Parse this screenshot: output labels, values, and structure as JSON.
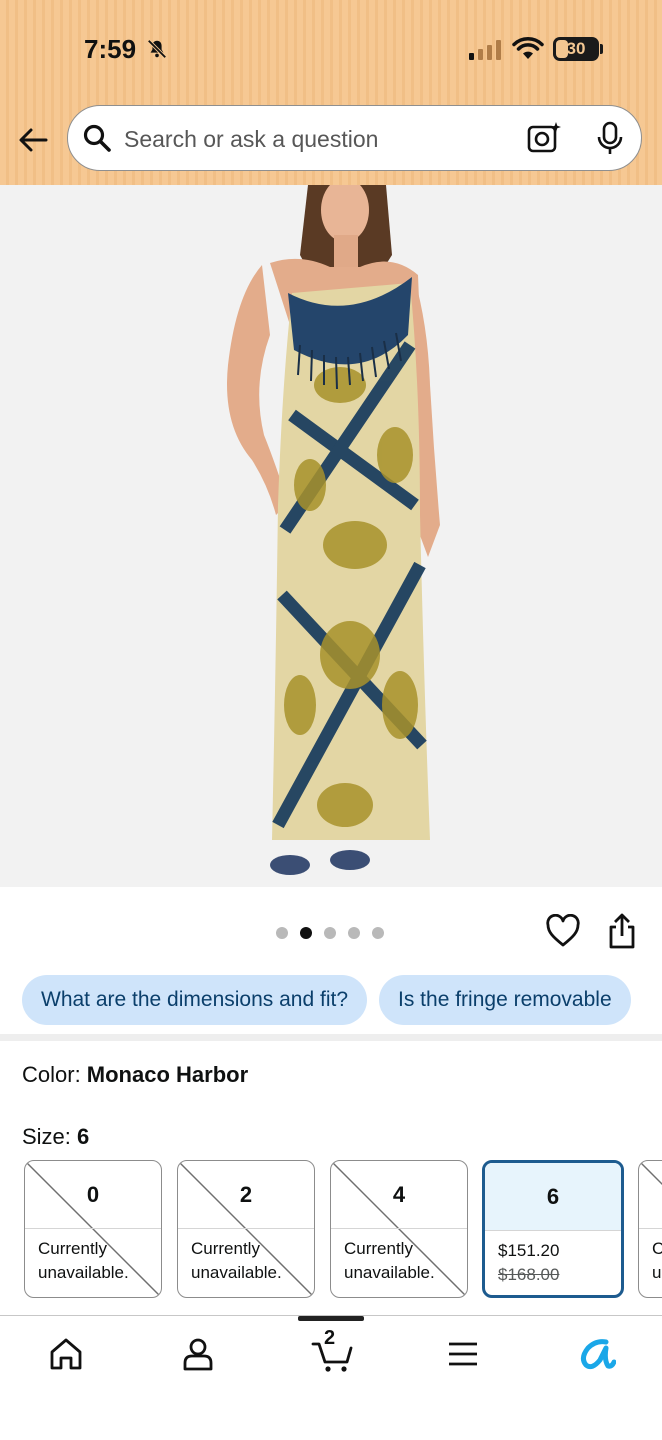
{
  "status_bar": {
    "time": "7:59",
    "battery": "30"
  },
  "search": {
    "placeholder": "Search or ask a question"
  },
  "gallery": {
    "dot_count": 5,
    "active_dot": 1
  },
  "questions": [
    "What are the dimensions and fit?",
    "Is the fringe removable"
  ],
  "color": {
    "label": "Color: ",
    "value": "Monaco Harbor"
  },
  "size": {
    "label": "Size: ",
    "value": "6"
  },
  "sizes": [
    {
      "size": "0",
      "line1": "Currently",
      "line2": "unavailable.",
      "available": false
    },
    {
      "size": "2",
      "line1": "Currently",
      "line2": "unavailable.",
      "available": false
    },
    {
      "size": "4",
      "line1": "Currently",
      "line2": "unavailable.",
      "available": false
    },
    {
      "size": "6",
      "line1": "$151.20",
      "line2": "$168.00",
      "available": true,
      "selected": true
    },
    {
      "size": "",
      "line1": "C",
      "line2": "u",
      "available": false
    }
  ],
  "nav": {
    "cart_count": "2"
  },
  "colors": {
    "header_bg": "#f6c893",
    "chip_bg": "#cfe4fa",
    "chip_text": "#0b3f6b",
    "selected_border": "#1d5b8f",
    "accent_ai": "#1aa7e8"
  }
}
